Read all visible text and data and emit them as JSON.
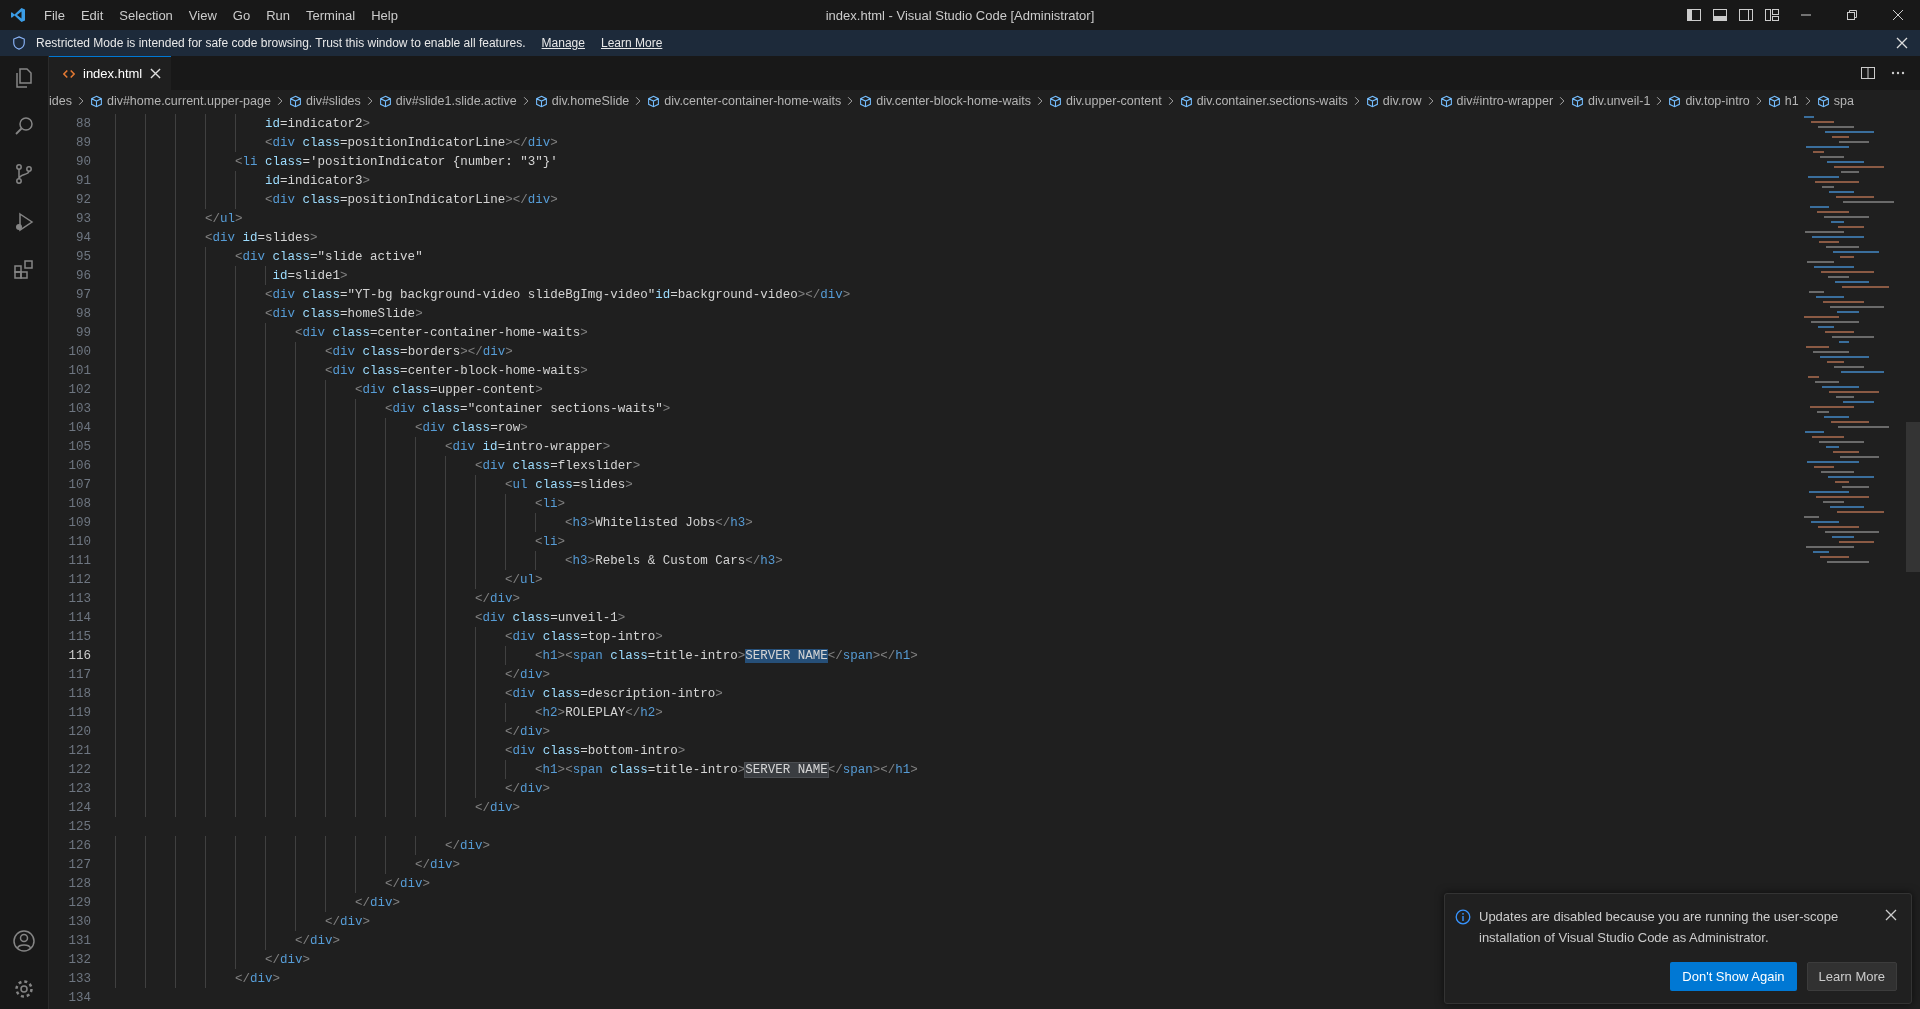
{
  "menu": [
    "File",
    "Edit",
    "Selection",
    "View",
    "Go",
    "Run",
    "Terminal",
    "Help"
  ],
  "window": {
    "title": "index.html - Visual Studio Code [Administrator]"
  },
  "banner": {
    "text": "Restricted Mode is intended for safe code browsing. Trust this window to enable all features.",
    "links": [
      "Manage",
      "Learn More"
    ]
  },
  "tabs": [
    {
      "label": "index.html",
      "selected": true
    }
  ],
  "breadcrumbs": [
    {
      "label": "ides",
      "kind": "plain"
    },
    {
      "label": "div#home.current.upper-page",
      "kind": "element"
    },
    {
      "label": "div#slides",
      "kind": "element"
    },
    {
      "label": "div#slide1.slide.active",
      "kind": "element"
    },
    {
      "label": "div.homeSlide",
      "kind": "element"
    },
    {
      "label": "div.center-container-home-waits",
      "kind": "element"
    },
    {
      "label": "div.center-block-home-waits",
      "kind": "element"
    },
    {
      "label": "div.upper-content",
      "kind": "element"
    },
    {
      "label": "div.container.sections-waits",
      "kind": "element"
    },
    {
      "label": "div.row",
      "kind": "element"
    },
    {
      "label": "div#intro-wrapper",
      "kind": "element"
    },
    {
      "label": "div.unveil-1",
      "kind": "element"
    },
    {
      "label": "div.top-intro",
      "kind": "element"
    },
    {
      "label": "h1",
      "kind": "element"
    },
    {
      "label": "spa",
      "kind": "element"
    }
  ],
  "editor": {
    "lines": [
      {
        "number": "88",
        "current": false,
        "segments": [
          {
            "text": "                    id=indicator2>",
            "selected": false,
            "matched": false
          }
        ]
      },
      {
        "number": "89",
        "current": false,
        "segments": [
          {
            "text": "                    <div class=positionIndicatorLine></div>",
            "selected": false,
            "matched": false
          }
        ]
      },
      {
        "number": "90",
        "current": false,
        "segments": [
          {
            "text": "                <li class='positionIndicator {number: \"3\"}'",
            "selected": false,
            "matched": false
          }
        ]
      },
      {
        "number": "91",
        "current": false,
        "segments": [
          {
            "text": "                    id=indicator3>",
            "selected": false,
            "matched": false
          }
        ]
      },
      {
        "number": "92",
        "current": false,
        "segments": [
          {
            "text": "                    <div class=positionIndicatorLine></div>",
            "selected": false,
            "matched": false
          }
        ]
      },
      {
        "number": "93",
        "current": false,
        "segments": [
          {
            "text": "            </ul>",
            "selected": false,
            "matched": false
          }
        ]
      },
      {
        "number": "94",
        "current": false,
        "segments": [
          {
            "text": "            <div id=slides>",
            "selected": false,
            "matched": false
          }
        ]
      },
      {
        "number": "95",
        "current": false,
        "segments": [
          {
            "text": "                <div class=\"slide active\"",
            "selected": false,
            "matched": false
          }
        ]
      },
      {
        "number": "96",
        "current": false,
        "segments": [
          {
            "text": "                     id=slide1>",
            "selected": false,
            "matched": false
          }
        ]
      },
      {
        "number": "97",
        "current": false,
        "segments": [
          {
            "text": "                    <div class=\"YT-bg background-video slideBgImg-video\"id=background-video></div>",
            "selected": false,
            "matched": false
          }
        ]
      },
      {
        "number": "98",
        "current": false,
        "segments": [
          {
            "text": "                    <div class=homeSlide>",
            "selected": false,
            "matched": false
          }
        ]
      },
      {
        "number": "99",
        "current": false,
        "segments": [
          {
            "text": "                        <div class=center-container-home-waits>",
            "selected": false,
            "matched": false
          }
        ]
      },
      {
        "number": "100",
        "current": false,
        "segments": [
          {
            "text": "                            <div class=borders></div>",
            "selected": false,
            "matched": false
          }
        ]
      },
      {
        "number": "101",
        "current": false,
        "segments": [
          {
            "text": "                            <div class=center-block-home-waits>",
            "selected": false,
            "matched": false
          }
        ]
      },
      {
        "number": "102",
        "current": false,
        "segments": [
          {
            "text": "                                <div class=upper-content>",
            "selected": false,
            "matched": false
          }
        ]
      },
      {
        "number": "103",
        "current": false,
        "segments": [
          {
            "text": "                                    <div class=\"container sections-waits\">",
            "selected": false,
            "matched": false
          }
        ]
      },
      {
        "number": "104",
        "current": false,
        "segments": [
          {
            "text": "                                        <div class=row>",
            "selected": false,
            "matched": false
          }
        ]
      },
      {
        "number": "105",
        "current": false,
        "segments": [
          {
            "text": "                                            <div id=intro-wrapper>",
            "selected": false,
            "matched": false
          }
        ]
      },
      {
        "number": "106",
        "current": false,
        "segments": [
          {
            "text": "                                                <div class=flexslider>",
            "selected": false,
            "matched": false
          }
        ]
      },
      {
        "number": "107",
        "current": false,
        "segments": [
          {
            "text": "                                                    <ul class=slides>",
            "selected": false,
            "matched": false
          }
        ]
      },
      {
        "number": "108",
        "current": false,
        "segments": [
          {
            "text": "                                                        <li>",
            "selected": false,
            "matched": false
          }
        ]
      },
      {
        "number": "109",
        "current": false,
        "segments": [
          {
            "text": "                                                            <h3>Whitelisted Jobs</h3>",
            "selected": false,
            "matched": false
          }
        ]
      },
      {
        "number": "110",
        "current": false,
        "segments": [
          {
            "text": "                                                        <li>",
            "selected": false,
            "matched": false
          }
        ]
      },
      {
        "number": "111",
        "current": false,
        "segments": [
          {
            "text": "                                                            <h3>Rebels & Custom Cars</h3>",
            "selected": false,
            "matched": false
          }
        ]
      },
      {
        "number": "112",
        "current": false,
        "segments": [
          {
            "text": "                                                    </ul>",
            "selected": false,
            "matched": false
          }
        ]
      },
      {
        "number": "113",
        "current": false,
        "segments": [
          {
            "text": "                                                </div>",
            "selected": false,
            "matched": false
          }
        ]
      },
      {
        "number": "114",
        "current": false,
        "segments": [
          {
            "text": "                                                <div class=unveil-1>",
            "selected": false,
            "matched": false
          }
        ]
      },
      {
        "number": "115",
        "current": false,
        "segments": [
          {
            "text": "                                                    <div class=top-intro>",
            "selected": false,
            "matched": false
          }
        ]
      },
      {
        "number": "116",
        "current": true,
        "segments": [
          {
            "text": "                                                        <h1><span class=title-intro>",
            "selected": false,
            "matched": false
          },
          {
            "text": "SERVER NAME",
            "selected": true,
            "matched": false
          },
          {
            "text": "</span></h1>",
            "selected": false,
            "matched": false
          }
        ]
      },
      {
        "number": "117",
        "current": false,
        "segments": [
          {
            "text": "                                                    </div>",
            "selected": false,
            "matched": false
          }
        ]
      },
      {
        "number": "118",
        "current": false,
        "segments": [
          {
            "text": "                                                    <div class=description-intro>",
            "selected": false,
            "matched": false
          }
        ]
      },
      {
        "number": "119",
        "current": false,
        "segments": [
          {
            "text": "                                                        <h2>ROLEPLAY</h2>",
            "selected": false,
            "matched": false
          }
        ]
      },
      {
        "number": "120",
        "current": false,
        "segments": [
          {
            "text": "                                                    </div>",
            "selected": false,
            "matched": false
          }
        ]
      },
      {
        "number": "121",
        "current": false,
        "segments": [
          {
            "text": "                                                    <div class=bottom-intro>",
            "selected": false,
            "matched": false
          }
        ]
      },
      {
        "number": "122",
        "current": false,
        "segments": [
          {
            "text": "                                                        <h1><span class=title-intro>",
            "selected": false,
            "matched": false
          },
          {
            "text": "SERVER NAME",
            "selected": false,
            "matched": true
          },
          {
            "text": "</span></h1>",
            "selected": false,
            "matched": false
          }
        ]
      },
      {
        "number": "123",
        "current": false,
        "segments": [
          {
            "text": "                                                    </div>",
            "selected": false,
            "matched": false
          }
        ]
      },
      {
        "number": "124",
        "current": false,
        "segments": [
          {
            "text": "                                                </div>",
            "selected": false,
            "matched": false
          }
        ]
      },
      {
        "number": "125",
        "current": false
      },
      {
        "number": "126",
        "current": false,
        "segments": [
          {
            "text": "                                            </div>",
            "selected": false,
            "matched": false
          }
        ]
      },
      {
        "number": "127",
        "current": false,
        "segments": [
          {
            "text": "                                        </div>",
            "selected": false,
            "matched": false
          }
        ]
      },
      {
        "number": "128",
        "current": false,
        "segments": [
          {
            "text": "                                    </div>",
            "selected": false,
            "matched": false
          }
        ]
      },
      {
        "number": "129",
        "current": false,
        "segments": [
          {
            "text": "                                </div>",
            "selected": false,
            "matched": false
          }
        ]
      },
      {
        "number": "130",
        "current": false,
        "segments": [
          {
            "text": "                            </div>",
            "selected": false,
            "matched": false
          }
        ]
      },
      {
        "number": "131",
        "current": false,
        "segments": [
          {
            "text": "                        </div>",
            "selected": false,
            "matched": false
          }
        ]
      },
      {
        "number": "132",
        "current": false,
        "segments": [
          {
            "text": "                    </div>",
            "selected": false,
            "matched": false
          }
        ]
      },
      {
        "number": "133",
        "current": false,
        "segments": [
          {
            "text": "                </div>",
            "selected": false,
            "matched": false
          }
        ]
      },
      {
        "number": "134",
        "current": false
      }
    ]
  },
  "notification": {
    "message": "Updates are disabled because you are running the user-scope installation of Visual Studio Code as Administrator.",
    "buttons": [
      {
        "label": "Don't Show Again",
        "kind": "primary"
      },
      {
        "label": "Learn More",
        "kind": "secondary"
      }
    ]
  }
}
